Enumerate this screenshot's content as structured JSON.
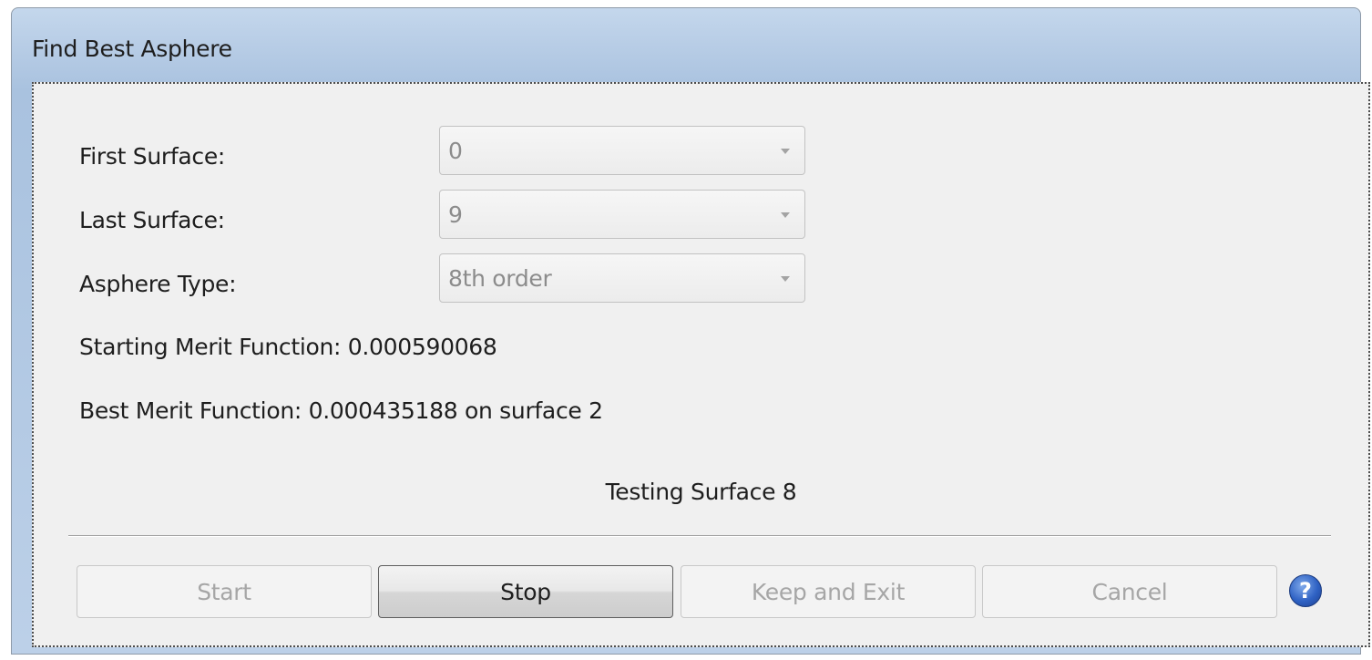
{
  "window": {
    "title": "Find Best Asphere"
  },
  "fields": {
    "first_surface": {
      "label": "First Surface:",
      "value": "0"
    },
    "last_surface": {
      "label": "Last Surface:",
      "value": "9"
    },
    "asphere_type": {
      "label": "Asphere Type:",
      "value": "8th order"
    }
  },
  "results": {
    "starting_merit": "Starting Merit Function: 0.000590068",
    "best_merit": "Best Merit Function: 0.000435188 on surface 2"
  },
  "status": "Testing Surface 8",
  "buttons": {
    "start": "Start",
    "stop": "Stop",
    "keep_exit": "Keep and Exit",
    "cancel": "Cancel",
    "help": "?"
  },
  "icons": {
    "help": "help-icon",
    "dropdown": "chevron-down-icon"
  },
  "colors": {
    "title_bar": "#b8cde6",
    "client_bg": "#f0f0f0",
    "help_icon": "#2f62c4",
    "disabled_text": "#a6a6a6"
  }
}
